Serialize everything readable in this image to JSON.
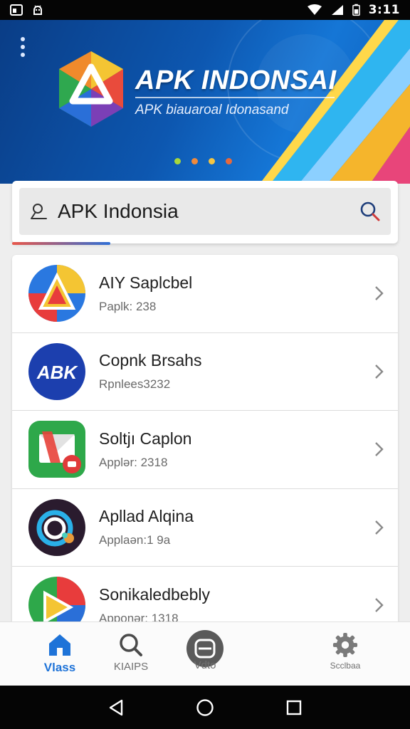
{
  "status_bar": {
    "time": "3:11",
    "left_icons": [
      "screenshot-icon",
      "android-debug-icon"
    ],
    "right_icons": [
      "wifi-icon",
      "signal-icon",
      "battery-icon"
    ]
  },
  "hero": {
    "title": "APK INDONSAI",
    "subtitle": "APK biauaroal Idonasand",
    "carousel_dot_colors": [
      "#a7d83c",
      "#f08a3c",
      "#f4c542",
      "#e8693c"
    ]
  },
  "search": {
    "value": "APK Indonsia",
    "placeholder": "APK Indonsia",
    "lead_icon": "search-bar-icon",
    "trail_icon": "magnifier-icon"
  },
  "apps": [
    {
      "name": "AIY Saplcbel",
      "meta": "Paplk: 238",
      "icon": "app-triangle-icon"
    },
    {
      "name": "Copnk Brsahs",
      "meta": "Rpnlees3232",
      "icon": "apk-badge-icon"
    },
    {
      "name": "Soltjı Caplon",
      "meta": "Applər: 2318",
      "icon": "mail-play-icon"
    },
    {
      "name": "Apllad Alqina",
      "meta": "Applaən:1 9a",
      "icon": "camera-lens-icon"
    },
    {
      "name": "Sonikaledbebly",
      "meta": "Apponər: 1318",
      "icon": "colorful-play-icon"
    }
  ],
  "bottom_nav": {
    "items": [
      {
        "label": "Vlass",
        "icon": "home-icon",
        "active": true
      },
      {
        "label": "KIAIPS",
        "icon": "search-icon",
        "active": false
      },
      {
        "label": "Vdto",
        "icon": "bot-icon",
        "active": false
      },
      {
        "label": "Scclbaa",
        "icon": "gear-icon",
        "active": false
      }
    ]
  },
  "colors": {
    "accent": "#1e73d8",
    "hero_bg": "#0d57b0"
  }
}
